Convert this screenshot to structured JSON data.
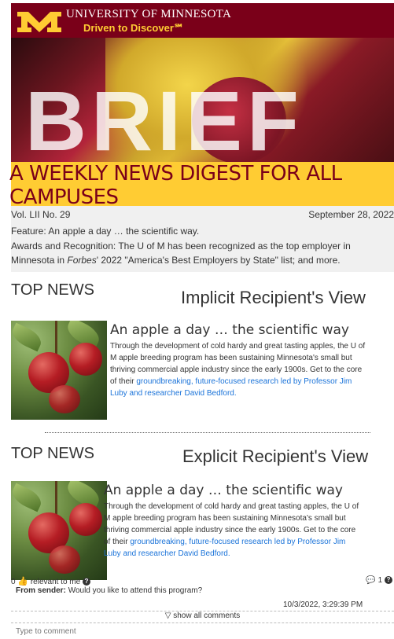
{
  "header": {
    "university": "UNIVERSITY OF MINNESOTA",
    "tagline": "Driven to Discover℠",
    "logo_icon": "umn-block-m-logo"
  },
  "hero": {
    "word": "BRIEF"
  },
  "digest": {
    "title": "A WEEKLY NEWS DIGEST FOR ALL CAMPUSES"
  },
  "meta": {
    "volume": "Vol. LII No. 29",
    "date": "September 28, 2022",
    "feature": "Feature: An apple a day … the scientific way.",
    "awards_pre": "Awards and Recognition: The U of M has been recognized as the top employer in Minnesota in ",
    "awards_em": "Forbes",
    "awards_post": "' 2022 \"America's Best Employers by State\" list; and more."
  },
  "implicit": {
    "section": "TOP NEWS",
    "view_label": "Implicit Recipient's View",
    "story_title": "An apple a day … the scientific way",
    "story_body": "Through the development of cold hardy and great tasting apples, the U of M apple breeding program has been sustaining Minnesota's small but thriving commercial apple industry since the early 1900s. Get to the core of their ",
    "story_link": "groundbreaking, future-focused research led by Professor Jim Luby and researcher David Bedford."
  },
  "explicit": {
    "section": "TOP NEWS",
    "view_label": "Explicit Recipient's View",
    "story_title": "An apple a day … the scientific way",
    "story_body": "Through the development of cold hardy and great tasting apples, the U of M apple breeding program has been sustaining Minnesota's small but thriving commercial apple industry since the early 1900s. Get to the core of their ",
    "story_link": "groundbreaking, future-focused research led by Professor Jim Luby and researcher David Bedford."
  },
  "feedback": {
    "relevant_count": "0",
    "relevant_label": "relevant to me",
    "comment_count": "1",
    "comment_from_label": "From sender:",
    "comment_text": "Would you like to attend this program?",
    "comment_time": "10/3/2022, 3:29:39 PM",
    "show_all": "▽ show all comments",
    "input_placeholder": "Type to comment"
  },
  "colors": {
    "maroon": "#7a0019",
    "gold": "#ffcc33",
    "link": "#1a73d9"
  }
}
